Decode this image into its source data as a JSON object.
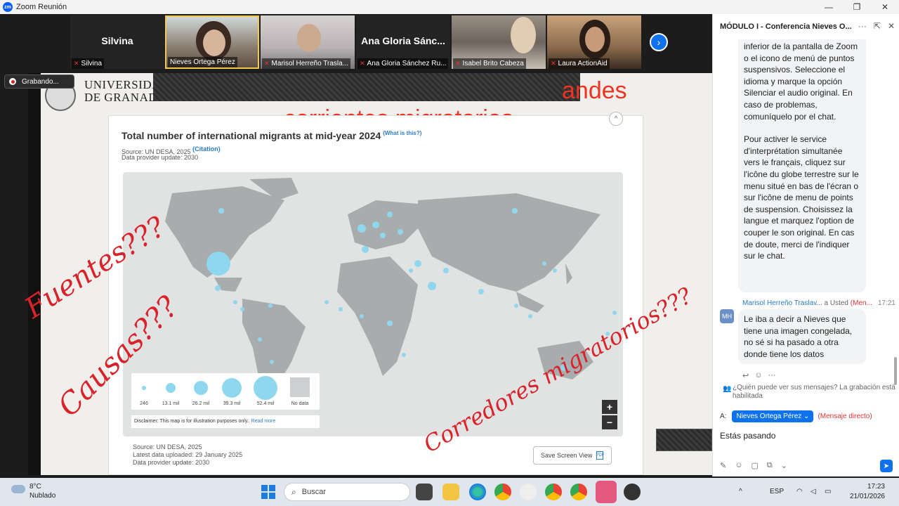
{
  "window": {
    "title": "Zoom Reunión",
    "minimize": "—",
    "restore": "❐",
    "close": "✕"
  },
  "gallery": {
    "tiles": [
      {
        "big_name": "Silvina",
        "label": "Silvina"
      },
      {
        "big_name": "",
        "label": "Nieves Ortega Pérez"
      },
      {
        "big_name": "",
        "label": "Marisol Herreño Trasla..."
      },
      {
        "big_name": "Ana Gloria Sánc...",
        "label": "Ana Gloria Sánchez Ru..."
      },
      {
        "big_name": "",
        "label": "Isabel Brito Cabeza"
      },
      {
        "big_name": "",
        "label": "Laura ActionAid"
      }
    ],
    "next_icon": "›"
  },
  "recording": {
    "label": "Grabando..."
  },
  "slide": {
    "university": [
      "UNIVERSIDAD",
      "DE GRANADA"
    ],
    "title_line1_visible": "andes",
    "title_line2": "corrientes migratorias",
    "panel": {
      "title": "Total number of international migrants at mid-year 2024",
      "what_is_this": "(What is this?)",
      "source": "Source: UN DESA, 2025",
      "citation": "(Citation)",
      "provider_update": "Data provider update: 2030",
      "collapse_icon": "^",
      "legend": [
        {
          "label": "246",
          "size": 246
        },
        {
          "label": "13.1 mil",
          "size": 13.1
        },
        {
          "label": "26.2 mil",
          "size": 26.2
        },
        {
          "label": "39.3 mil",
          "size": 39.3
        },
        {
          "label": "52.4 mil",
          "size": 52.4
        },
        {
          "label": "No data"
        }
      ],
      "disclaimer": "Disclaimer: This map is for illustration purposes only..",
      "read_more": "Read more",
      "zoom_in": "+",
      "zoom_out": "−",
      "footer_source": "Source: UN DESA, 2025",
      "footer_uploaded": "Latest data uploaded: 29 January 2025",
      "footer_update": "Data provider update: 2030",
      "save_button": "Save Screen View",
      "pdf_icon": "PDF"
    },
    "annotations": [
      "Fuentes???",
      "Causas???",
      "Corredores migratorios???"
    ]
  },
  "chat": {
    "header": "MÓDULO I - Conferencia Nieves O...",
    "icons": {
      "more": "···",
      "popout": "⇱",
      "close": "✕"
    },
    "message1_paragraphs": [
      "inferior de la pantalla de Zoom o el icono de menú de puntos suspensivos. Seleccione el idioma y marque la opción Silenciar el audio original. En caso de problemas, comuníquelo por el chat.",
      "Pour activer le service d'interprétation simultanée vers le français, cliquez sur l'icône du globe terrestre sur le menu situé en bas de l'écran o sur l'icône de menu de points de suspension. Choisissez la langue et marquez l'option de couper le son original. En cas de doute, merci de l'indiquer sur le chat."
    ],
    "sender_name": "Marisol Herreño Traslav...",
    "sender_to": "a Usted",
    "sender_dm": "(Men...",
    "sender_time": "17:21",
    "avatar_initials": "MH",
    "message2": "Le iba a decir a Nieves que tiene una imagen congelada, no sé si ha pasado a otra donde tiene los datos",
    "reactions": [
      "↩",
      "☺",
      "···"
    ],
    "notice": "¿Quién puede ver sus mensajes? La grabación está habilitada",
    "recipient_label": "A:",
    "recipient_name": "Nieves Ortega Pérez ⌄",
    "recipient_type": "(Mensaje directo)",
    "input_value": "Estás pasando",
    "tools": [
      "✎",
      "☺",
      "▢",
      "⧉",
      "⌄"
    ],
    "send_icon": "➤"
  },
  "taskbar": {
    "temperature": "8°C",
    "condition": "Nublado",
    "search_placeholder": "Buscar",
    "search_icon": "⌕",
    "language": "ESP",
    "caret": "^",
    "time": "17:23",
    "date": "21/01/2026"
  }
}
